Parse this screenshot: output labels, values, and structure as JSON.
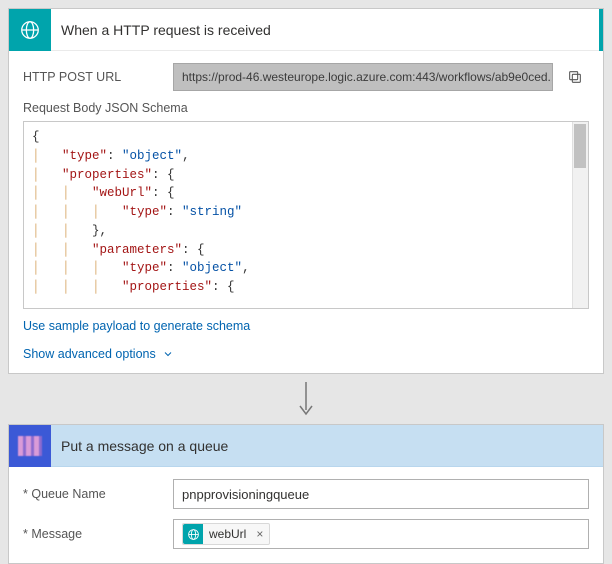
{
  "trigger": {
    "title": "When a HTTP request is received",
    "url_label": "HTTP POST URL",
    "url_value": "https://prod-46.westeurope.logic.azure.com:443/workflows/ab9e0ced...",
    "schema_label": "Request Body JSON Schema",
    "sample_link": "Use sample payload to generate schema",
    "advanced_link": "Show advanced options"
  },
  "action": {
    "title": "Put a message on a queue",
    "queue_label": "Queue Name",
    "queue_value": "pnpprovisioningqueue",
    "message_label": "Message",
    "message_token": "webUrl"
  },
  "schema_lines": [
    {
      "indent": 0,
      "content": [
        {
          "t": "p",
          "v": "{"
        }
      ]
    },
    {
      "indent": 1,
      "content": [
        {
          "t": "k",
          "v": "\"type\""
        },
        {
          "t": "p",
          "v": ": "
        },
        {
          "t": "s",
          "v": "\"object\""
        },
        {
          "t": "p",
          "v": ","
        }
      ]
    },
    {
      "indent": 1,
      "content": [
        {
          "t": "k",
          "v": "\"properties\""
        },
        {
          "t": "p",
          "v": ": {"
        }
      ]
    },
    {
      "indent": 2,
      "content": [
        {
          "t": "k",
          "v": "\"webUrl\""
        },
        {
          "t": "p",
          "v": ": {"
        }
      ]
    },
    {
      "indent": 3,
      "content": [
        {
          "t": "k",
          "v": "\"type\""
        },
        {
          "t": "p",
          "v": ": "
        },
        {
          "t": "s",
          "v": "\"string\""
        }
      ]
    },
    {
      "indent": 2,
      "content": [
        {
          "t": "p",
          "v": "},"
        }
      ]
    },
    {
      "indent": 2,
      "content": [
        {
          "t": "k",
          "v": "\"parameters\""
        },
        {
          "t": "p",
          "v": ": {"
        }
      ]
    },
    {
      "indent": 3,
      "content": [
        {
          "t": "k",
          "v": "\"type\""
        },
        {
          "t": "p",
          "v": ": "
        },
        {
          "t": "s",
          "v": "\"object\""
        },
        {
          "t": "p",
          "v": ","
        }
      ]
    },
    {
      "indent": 3,
      "content": [
        {
          "t": "k",
          "v": "\"properties\""
        },
        {
          "t": "p",
          "v": ": {"
        }
      ]
    }
  ]
}
